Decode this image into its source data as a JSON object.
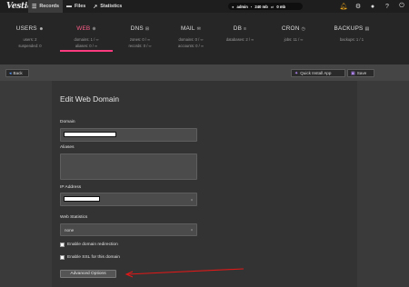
{
  "app": {
    "logo": "Vestia"
  },
  "topnav": [
    {
      "label": "Records",
      "icon": "list-icon"
    },
    {
      "label": "Files",
      "icon": "folder-icon"
    },
    {
      "label": "Statistics",
      "icon": "chart-icon"
    }
  ],
  "user": {
    "name": "admin",
    "disk": "240 mb",
    "bandwidth": "0 mb"
  },
  "stats": [
    {
      "title": "USERS",
      "lines": [
        "users: 2",
        "suspended: 0"
      ]
    },
    {
      "title": "WEB",
      "lines": [
        "domains: 1 / ∞",
        "aliases: 0 / ∞"
      ]
    },
    {
      "title": "DNS",
      "lines": [
        "zones: 0 / ∞",
        "records: 0 / ∞"
      ]
    },
    {
      "title": "MAIL",
      "lines": [
        "domains: 0 / ∞",
        "accounts: 0 / ∞"
      ]
    },
    {
      "title": "DB",
      "lines": [
        "databases: 2 / ∞",
        ""
      ]
    },
    {
      "title": "CRON",
      "lines": [
        "jobs: 11 / ∞",
        ""
      ]
    },
    {
      "title": "BACKUPS",
      "lines": [
        "backups: 1 / 1",
        ""
      ]
    }
  ],
  "toolbar": {
    "back": "Back",
    "quick_install": "Quick Install App",
    "save": "Save"
  },
  "form": {
    "title": "Edit Web Domain",
    "domain_label": "Domain",
    "aliases_label": "Aliases",
    "ip_label": "IP Address",
    "stats_label": "Web Statistics",
    "stats_value": "none",
    "redirect_label": "Enable domain redirection",
    "ssl_label": "Enable SSL for this domain",
    "advanced": "Advanced Options"
  },
  "colors": {
    "accent": "#ff3b7f",
    "annotation": "#e01818",
    "bell": "#e8a31c"
  }
}
